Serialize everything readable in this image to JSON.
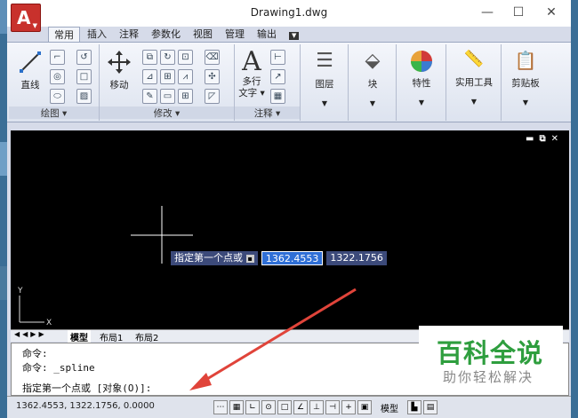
{
  "window": {
    "title": "Drawing1.dwg"
  },
  "tabs": [
    "常用",
    "插入",
    "注释",
    "参数化",
    "视图",
    "管理",
    "输出"
  ],
  "panels": {
    "draw": "绘图",
    "modify": "修改",
    "annotation": "注释"
  },
  "tools": {
    "line": "直线",
    "move": "移动",
    "mtext": "多行\n文字",
    "layers": "图层",
    "block": "块",
    "properties": "特性",
    "utilities": "实用工具",
    "clipboard": "剪贴板"
  },
  "tooltip": {
    "prompt": "指定第一个点或",
    "x": "1362.4553",
    "y": "1322.1756"
  },
  "layout_tabs": [
    "模型",
    "布局1",
    "布局2"
  ],
  "axis": {
    "x": "X",
    "y": "Y"
  },
  "command": {
    "line1": "命令:",
    "line2": "命令: _spline",
    "prompt": "指定第一个点或 [对象(O)]:"
  },
  "status": {
    "coords": "1362.4553,  1322.1756, 0.0000",
    "model": "模型"
  },
  "watermark": {
    "title": "百科全说",
    "subtitle": "助你轻松解决"
  },
  "colors": {
    "app": "#c8312c",
    "canvas": "#000000",
    "arrow": "#e0443a",
    "watermark": "#2e9e3e"
  }
}
